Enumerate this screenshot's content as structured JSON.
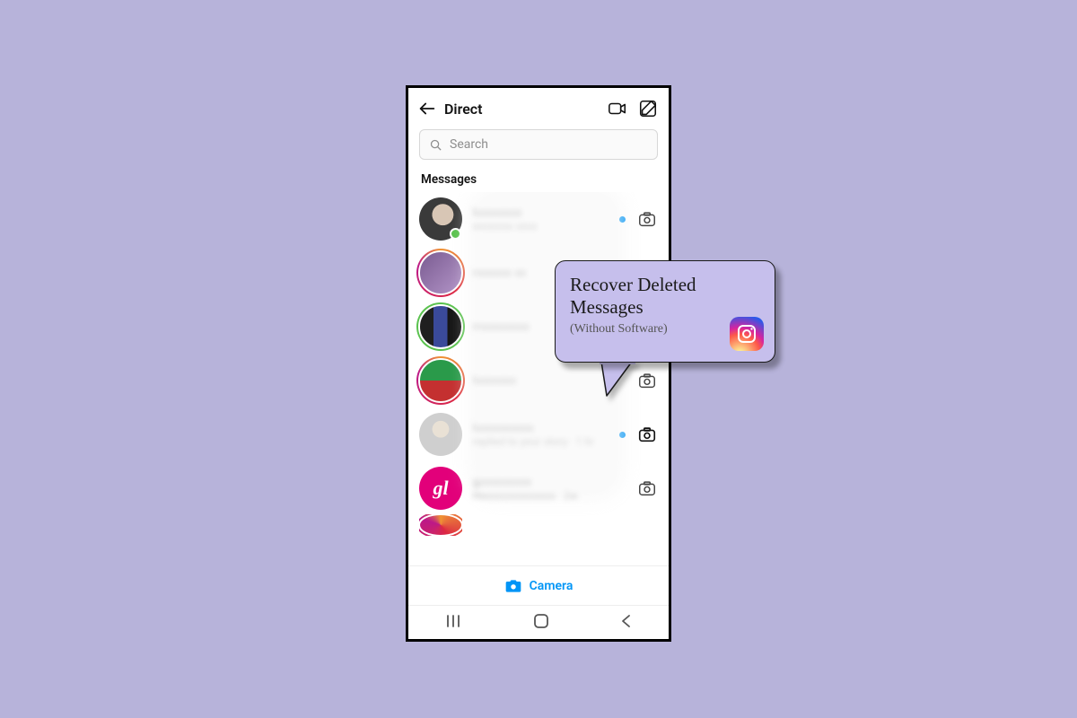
{
  "header": {
    "title": "Direct"
  },
  "search": {
    "placeholder": "Search"
  },
  "section_label": "Messages",
  "rows": [
    {
      "name": "lxxxxxxxx",
      "sub": "wxxxxxx xxxx",
      "unread": true,
      "camera": true,
      "ring": "none",
      "presence": true
    },
    {
      "name": "rxxxxxx xx",
      "sub": "",
      "unread": false,
      "camera": false,
      "ring": "story",
      "presence": false
    },
    {
      "name": "mxxxxxxxx",
      "sub": "",
      "unread": false,
      "camera": false,
      "ring": "green",
      "presence": false
    },
    {
      "name": "lxxxxxxx",
      "sub": "",
      "unread": false,
      "camera": true,
      "ring": "story",
      "presence": false
    },
    {
      "name": "lxxxxxxxxxx",
      "sub": "replied to your story · 1 hr",
      "unread": true,
      "camera": true,
      "ring": "none",
      "presence": false
    },
    {
      "name": "gxxxxxxxxx",
      "sub": "Hxxxxxxxxxxxxxx · 2w",
      "unread": false,
      "camera": true,
      "ring": "none",
      "presence": false
    },
    {
      "name": "",
      "sub": "",
      "unread": false,
      "camera": false,
      "ring": "story",
      "presence": false
    }
  ],
  "camera_bar": {
    "label": "Camera"
  },
  "callout": {
    "line1": "Recover Deleted",
    "line2": "Messages",
    "sub": "(Without Software)"
  },
  "avatar6_text": "gl"
}
